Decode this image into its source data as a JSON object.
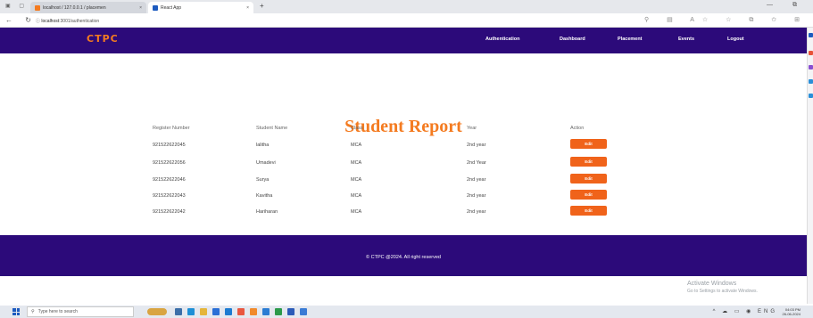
{
  "browser": {
    "tabs": [
      {
        "label": "localhost / 127.0.0.1 / placemen",
        "close": "×"
      },
      {
        "label": "React App",
        "close": "×"
      }
    ],
    "new_tab": "+",
    "url_host": "localhost",
    "url_path": ":3001/authentication"
  },
  "nav": {
    "brand": "CTPC",
    "links": [
      "Authentication",
      "Dashboard",
      "Placement",
      "Events",
      "Logout"
    ]
  },
  "page": {
    "title": "Student Report",
    "table": {
      "headers": [
        "Register Number",
        "Student Name",
        "Class",
        "Year",
        "Action"
      ],
      "rows": [
        {
          "reg": "921522622045",
          "name": "lalitha",
          "class": "MCA",
          "year": "2nd year",
          "action": "Edit"
        },
        {
          "reg": "921522622056",
          "name": "Umadevi",
          "class": "MCA",
          "year": "2nd Year",
          "action": "Edit"
        },
        {
          "reg": "921522622046",
          "name": "Surya",
          "class": "MCA",
          "year": "2nd year",
          "action": "Edit"
        },
        {
          "reg": "921522622043",
          "name": "Kavitha",
          "class": "MCA",
          "year": "2nd year",
          "action": "Edit"
        },
        {
          "reg": "921522622042",
          "name": "Hariharan",
          "class": "MCA",
          "year": "2nd year",
          "action": "Edit"
        }
      ]
    }
  },
  "footer": {
    "text": "© CTPC @2024. All right reserved"
  },
  "watermark": {
    "title": "Activate Windows",
    "subtitle": "Go to Settings to activate Windows."
  },
  "taskbar": {
    "search_placeholder": "Type here to search",
    "lang": "ENG",
    "time": "04:03 PM",
    "date": "26-06-2024"
  },
  "colors": {
    "nav_bg": "#2c0a7a",
    "accent": "#f47b20",
    "edit_button": "#f0631a"
  }
}
